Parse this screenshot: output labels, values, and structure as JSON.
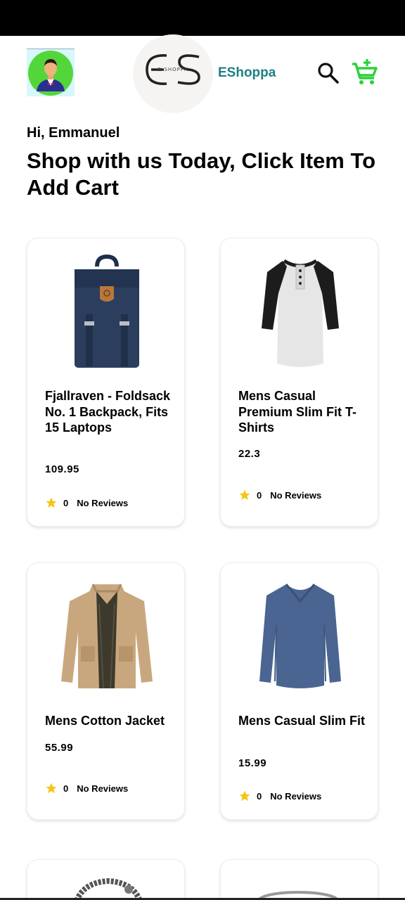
{
  "header": {
    "brand_name": "EShoppa",
    "logo_text": "ES",
    "logo_subtext": "E-SHOPPA"
  },
  "greeting": "Hi, Emmanuel",
  "headline": "Shop with us Today, Click Item To Add Cart",
  "colors": {
    "brand": "#1d7f86",
    "cart_icon": "#2bd13b",
    "star": "#f5c518"
  },
  "products": [
    {
      "title": "Fjallraven - Foldsack No. 1 Backpack, Fits 15 Laptops",
      "price": "109.95",
      "rating": "0",
      "reviews": "No Reviews",
      "icon": "backpack"
    },
    {
      "title": "Mens Casual Premium Slim Fit T-Shirts",
      "price": "22.3",
      "rating": "0",
      "reviews": "No Reviews",
      "icon": "raglan-tshirt"
    },
    {
      "title": "Mens Cotton Jacket",
      "price": "55.99",
      "rating": "0",
      "reviews": "No Reviews",
      "icon": "jacket"
    },
    {
      "title": "Mens Casual Slim Fit",
      "price": "15.99",
      "rating": "0",
      "reviews": "No Reviews",
      "icon": "long-sleeve-shirt"
    }
  ]
}
